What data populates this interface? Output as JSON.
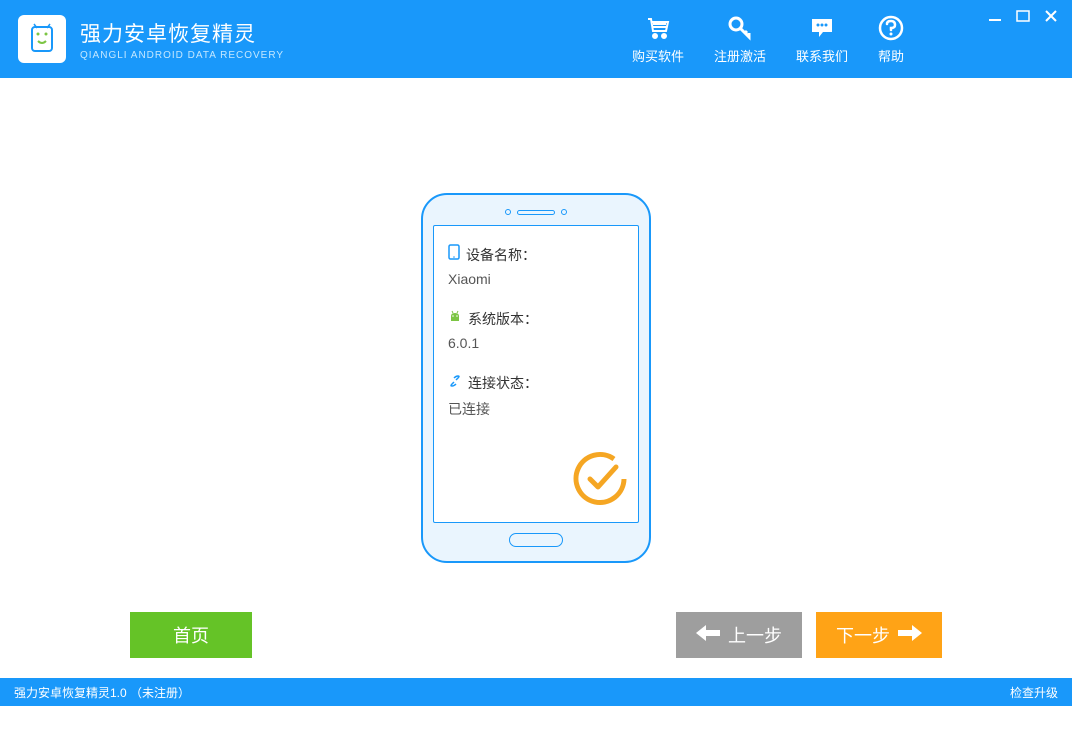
{
  "header": {
    "title": "强力安卓恢复精灵",
    "subtitle": "QIANGLI ANDROID DATA RECOVERY",
    "actions": {
      "buy": "购买软件",
      "activate": "注册激活",
      "contact": "联系我们",
      "help": "帮助"
    }
  },
  "device": {
    "name_label": "设备名称：",
    "name_value": "Xiaomi",
    "version_label": "系统版本：",
    "version_value": "6.0.1",
    "status_label": "连接状态：",
    "status_value": "已连接"
  },
  "buttons": {
    "home": "首页",
    "prev": "上一步",
    "next": "下一步"
  },
  "footer": {
    "status": "强力安卓恢复精灵1.0 （未注册）",
    "update": "检查升级"
  }
}
